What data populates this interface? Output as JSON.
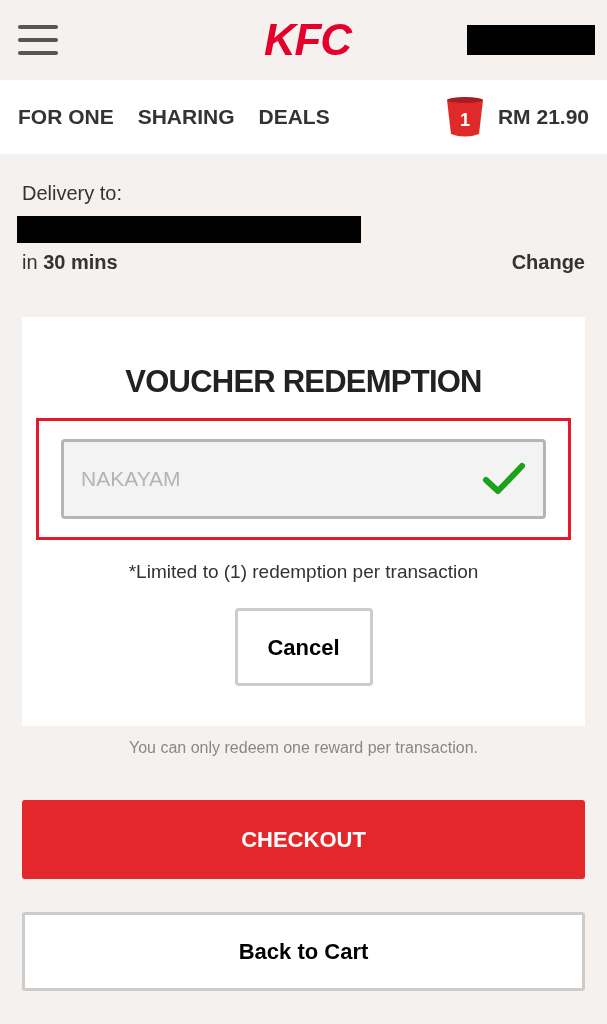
{
  "header": {
    "logo": "KFC"
  },
  "nav": {
    "items": [
      {
        "label": "FOR ONE"
      },
      {
        "label": "SHARING"
      },
      {
        "label": "DEALS"
      }
    ],
    "cart": {
      "count": "1",
      "total": "RM 21.90"
    }
  },
  "delivery": {
    "label": "Delivery to:",
    "eta_prefix": "in",
    "eta": "30 mins",
    "change": "Change"
  },
  "voucher": {
    "title": "VOUCHER REDEMPTION",
    "code": "NAKAYAM",
    "valid": true,
    "highlighted": true,
    "limit_note": "*Limited to (1) redemption per transaction",
    "cancel": "Cancel"
  },
  "note": "You can only redeem one reward per transaction.",
  "buttons": [
    {
      "kind": "primary",
      "label": "CHECKOUT"
    },
    {
      "kind": "secondary",
      "label": "Back to Cart"
    }
  ]
}
